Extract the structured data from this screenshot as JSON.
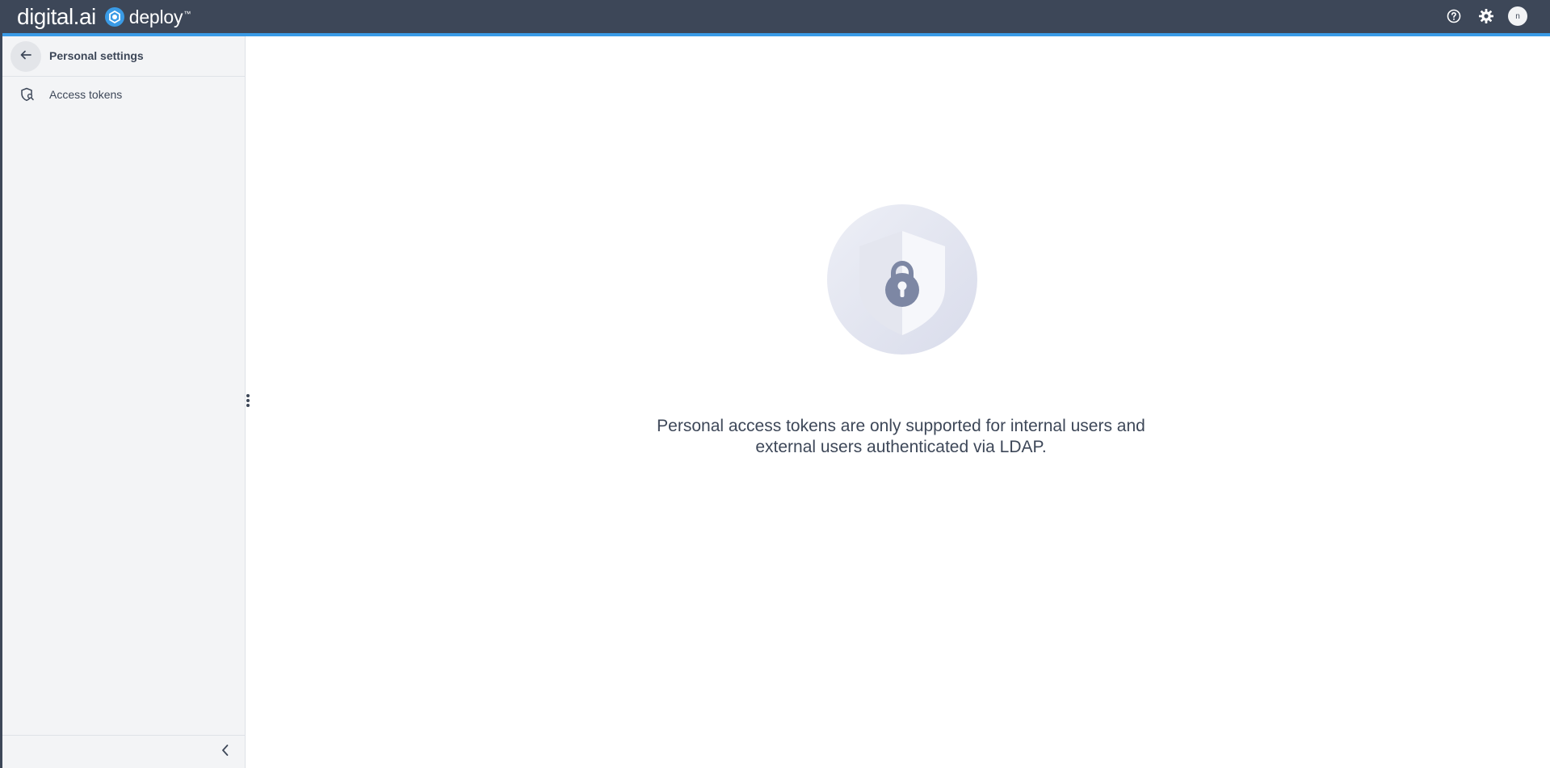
{
  "header": {
    "brand_primary": "digital.ai",
    "brand_product": "deploy",
    "brand_tm": "™",
    "help_icon": "help-icon",
    "settings_icon": "gear-icon",
    "avatar_initial": "n"
  },
  "sidebar": {
    "title": "Personal settings",
    "back_icon": "arrow-left-icon",
    "items": [
      {
        "label": "Access tokens",
        "icon": "shield-key-icon"
      }
    ],
    "collapse_icon": "chevron-left-icon"
  },
  "main": {
    "illustration_icon": "shield-lock-icon",
    "message_line1": "Personal access tokens are only supported for internal users and",
    "message_line2": "external users authenticated via LDAP."
  },
  "colors": {
    "topbar": "#3d4758",
    "accent": "#3a9be6",
    "sidebar_bg": "#f3f4f6",
    "text": "#3d4758"
  }
}
